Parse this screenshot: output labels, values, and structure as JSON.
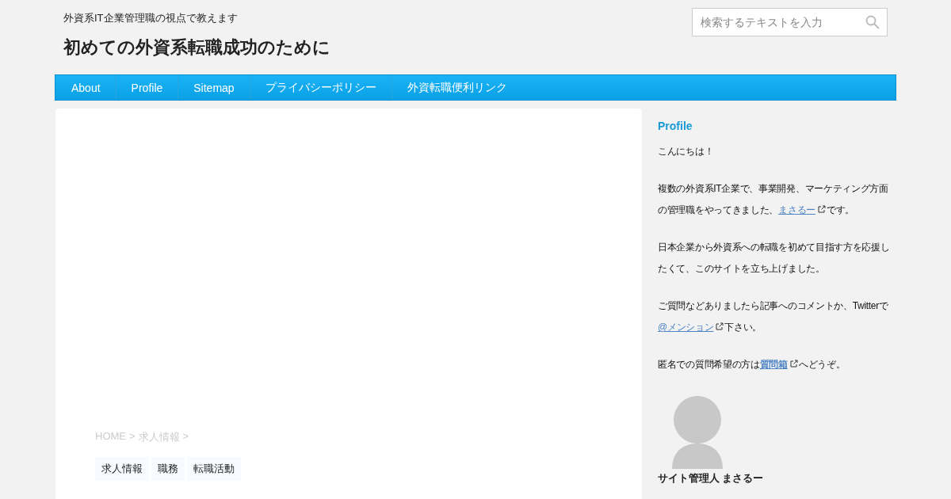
{
  "header": {
    "tagline": "外資系IT企業管理職の視点で教えます",
    "title": "初めての外資系転職成功のために",
    "search": {
      "placeholder": "検索するテキストを入力"
    }
  },
  "nav": [
    "About",
    "Profile",
    "Sitemap",
    "プライバシーポリシー",
    "外資転職便利リンク"
  ],
  "main": {
    "breadcrumb": [
      "HOME",
      "求人情報"
    ],
    "breadcrumb_separator": ">",
    "tags": [
      "求人情報",
      "職務",
      "転職活動"
    ]
  },
  "sidebar": {
    "heading": "Profile",
    "paragraphs": [
      [
        {
          "kind": "text",
          "text": "こんにちは！"
        }
      ],
      [
        {
          "kind": "text",
          "text": "複数の外資系IT企業で、事業開発、マーケティング方面の管理職をやってきました、"
        },
        {
          "kind": "link",
          "text": "まさるー"
        },
        {
          "kind": "text",
          "text": "です。"
        }
      ],
      [
        {
          "kind": "text",
          "text": "日本企業から外資系への転職を初めて目指す方を応援したくて、このサイトを立ち上げました。"
        }
      ],
      [
        {
          "kind": "text",
          "text": "ご質問などありましたら記事へのコメントか、Twitterで"
        },
        {
          "kind": "link",
          "text": "@メンション"
        },
        {
          "kind": "text",
          "text": "下さい。"
        }
      ],
      [
        {
          "kind": "text",
          "text": "匿名での質問希望の方は"
        },
        {
          "kind": "boldlink",
          "text": "質問箱"
        },
        {
          "kind": "text",
          "text": "へどうぞ。"
        }
      ]
    ],
    "caption": "サイト管理人 まさるー"
  }
}
